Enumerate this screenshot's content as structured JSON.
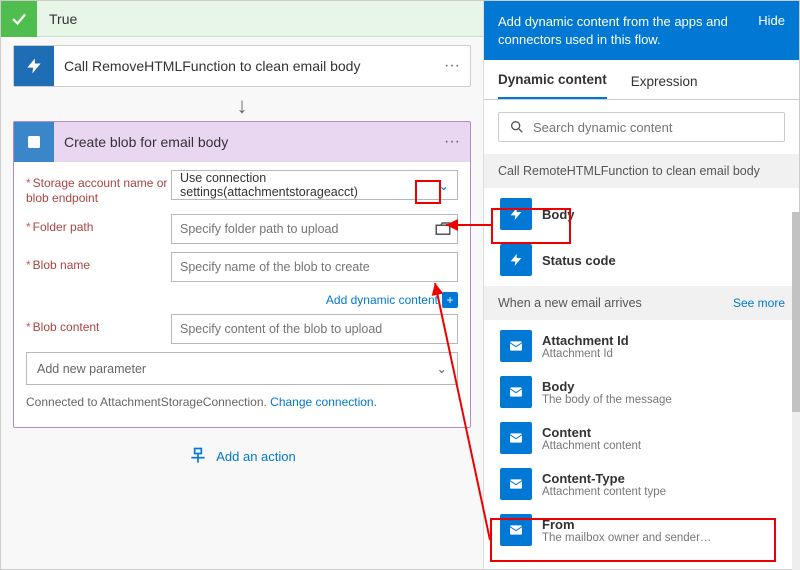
{
  "condition": {
    "label": "True"
  },
  "step1": {
    "title": "Call RemoveHTMLFunction to clean email body"
  },
  "step2": {
    "title": "Create blob for email body",
    "fields": {
      "storage_label": "Storage account name or blob endpoint",
      "storage_value": "Use connection settings(attachmentstorageacct)",
      "folder_label": "Folder path",
      "folder_placeholder": "Specify folder path to upload",
      "blobname_label": "Blob name",
      "blobname_placeholder": "Specify name of the blob to create",
      "blobcontent_label": "Blob content",
      "blobcontent_placeholder": "Specify content of the blob to upload"
    },
    "dyn_link": "Add dynamic content",
    "add_param": "Add new parameter",
    "connected_pre": "Connected to AttachmentStorageConnection. ",
    "connected_link": "Change connection."
  },
  "add_action": "Add an action",
  "panel": {
    "header": "Add dynamic content from the apps and connectors used in this flow.",
    "hide": "Hide",
    "tabs": {
      "dynamic": "Dynamic content",
      "expression": "Expression"
    },
    "search_placeholder": "Search dynamic content",
    "sections": [
      {
        "title": "Call RemoteHTMLFunction to clean email body"
      },
      {
        "title": "When a new email arrives",
        "see_more": "See more"
      }
    ],
    "items1": [
      {
        "title": "Body"
      },
      {
        "title": "Status code"
      }
    ],
    "items2": [
      {
        "title": "Attachment Id",
        "sub": "Attachment Id"
      },
      {
        "title": "Body",
        "sub": "The body of the message"
      },
      {
        "title": "Content",
        "sub": "Attachment content"
      },
      {
        "title": "Content-Type",
        "sub": "Attachment content type"
      },
      {
        "title": "From",
        "sub": "The mailbox owner and sender…"
      }
    ]
  }
}
